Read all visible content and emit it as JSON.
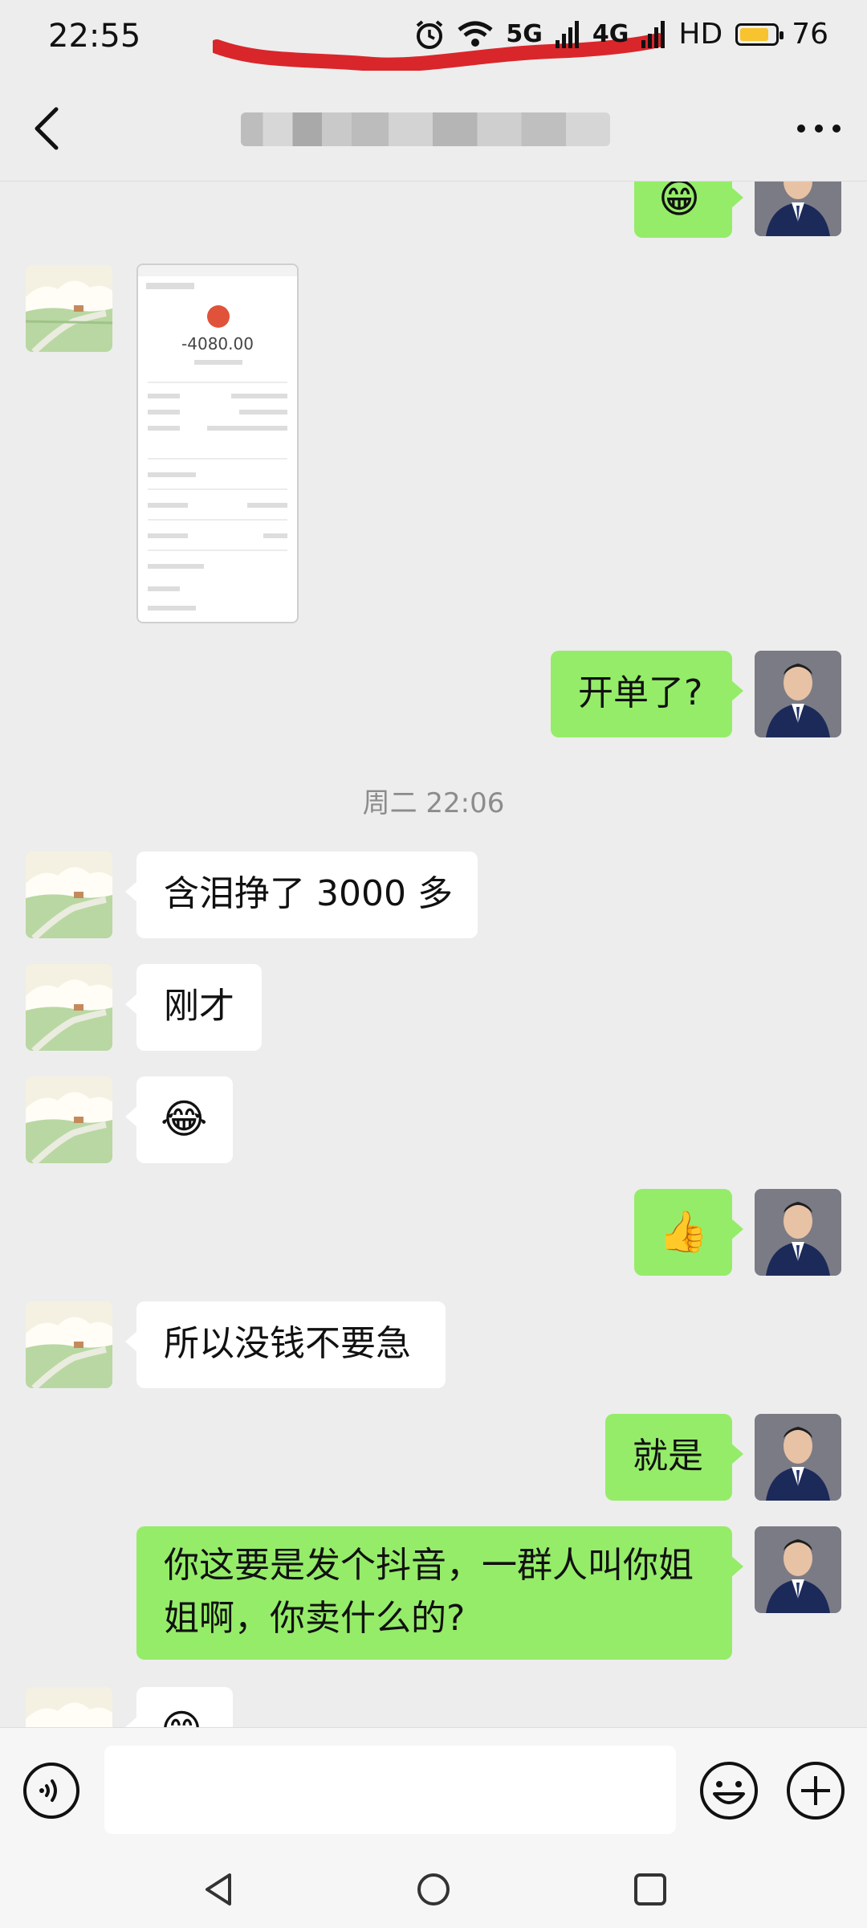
{
  "status_bar": {
    "time": "22:55",
    "network_5g": "5G",
    "network_4g": "4G",
    "hd_label": "HD",
    "battery": "76"
  },
  "header": {
    "title": ""
  },
  "messages": {
    "top_right_emoji": "😁",
    "outgoing_1": "开单了?",
    "timestamp": "周二 22:06",
    "incoming_1": "含泪挣了 3000 多",
    "incoming_2": "刚才",
    "incoming_3_emoji": "😂",
    "outgoing_thumbs_emoji": "👍",
    "incoming_4": "所以没钱不要急",
    "outgoing_2": "就是",
    "outgoing_3": "你这要是发个抖音，一群人叫你姐姐啊，你卖什么的?",
    "incoming_5_emoji": "😊"
  },
  "screenshot_thumb": {
    "amount": "-4080.00"
  },
  "input": {
    "value": "",
    "placeholder": ""
  }
}
